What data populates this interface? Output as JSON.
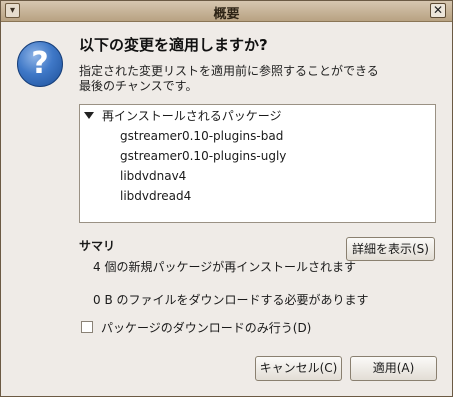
{
  "window": {
    "title": "概要",
    "menu_icon": "window-menu-icon",
    "close_symbol": "✕"
  },
  "dialog": {
    "heading": "以下の変更を適用しますか?",
    "description": "指定された変更リストを適用前に参照することができる最後のチャンスです。"
  },
  "tree": {
    "group_label": "再インストールされるパッケージ",
    "items": [
      "gstreamer0.10-plugins-bad",
      "gstreamer0.10-plugins-ugly",
      "libdvdnav4",
      "libdvdread4"
    ]
  },
  "summary": {
    "title": "サマリ",
    "line1": "4 個の新規パッケージが再インストールされます",
    "line2": "0  B のファイルをダウンロードする必要があります"
  },
  "buttons": {
    "details": "詳細を表示(S)",
    "cancel": "キャンセル(C)",
    "apply": "適用(A)"
  },
  "options": {
    "download_only_label": "パッケージのダウンロードのみ行う(D)",
    "download_only_checked": false
  },
  "icons": {
    "dialog_icon": "question-icon"
  },
  "colors": {
    "titlebar": "#c8b496",
    "accent": "#3f78c7",
    "background": "#efebe7"
  }
}
